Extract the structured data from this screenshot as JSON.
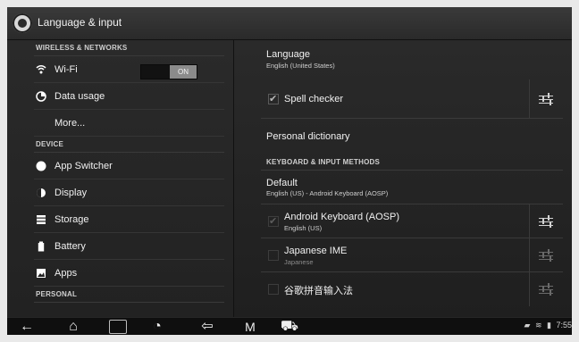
{
  "window": {
    "title": "Language & input",
    "icon": "gear-icon"
  },
  "left": {
    "sections": [
      {
        "label": "WIRELESS & NETWORKS"
      },
      {
        "label": "DEVICE"
      },
      {
        "label": "PERSONAL"
      }
    ],
    "items": [
      {
        "label": "Wi-Fi",
        "icon": "wifi-icon",
        "toggle": "ON"
      },
      {
        "label": "Data usage",
        "icon": "data-usage-icon"
      },
      {
        "label": "More..."
      },
      {
        "label": "App Switcher",
        "icon": "app-switcher-icon"
      },
      {
        "label": "Display",
        "icon": "display-icon"
      },
      {
        "label": "Storage",
        "icon": "storage-icon"
      },
      {
        "label": "Battery",
        "icon": "battery-icon"
      },
      {
        "label": "Apps",
        "icon": "apps-icon"
      }
    ]
  },
  "right": {
    "language": {
      "title": "Language",
      "subtitle": "English (United States)"
    },
    "spell_checker": {
      "label": "Spell checker",
      "checked": true
    },
    "personal_dictionary": {
      "label": "Personal dictionary"
    },
    "keyboard_section": {
      "label": "KEYBOARD & INPUT METHODS"
    },
    "default": {
      "title": "Default",
      "subtitle": "English (US) - Android Keyboard (AOSP)"
    },
    "methods": [
      {
        "title": "Android Keyboard (AOSP)",
        "subtitle": "English (US)",
        "checked": true,
        "dim": true
      },
      {
        "title": "Japanese IME",
        "subtitle": "Japanese",
        "checked": false,
        "dim": true
      },
      {
        "title": "谷歌拼音输入法",
        "subtitle": "",
        "checked": false,
        "dim": true
      }
    ]
  },
  "navbar": {
    "buttons": [
      {
        "name": "back-icon",
        "glyph": "←"
      },
      {
        "name": "home-icon",
        "glyph": "⌂"
      },
      {
        "name": "recent-apps-icon",
        "glyph": "▭"
      },
      {
        "name": "browser-icon",
        "glyph": "◔"
      },
      {
        "name": "exit-icon",
        "glyph": "⇦"
      },
      {
        "name": "maintenance-icon",
        "glyph": "M"
      },
      {
        "name": "car-icon",
        "glyph": "⛟"
      }
    ],
    "status": {
      "time": "7:55"
    }
  }
}
